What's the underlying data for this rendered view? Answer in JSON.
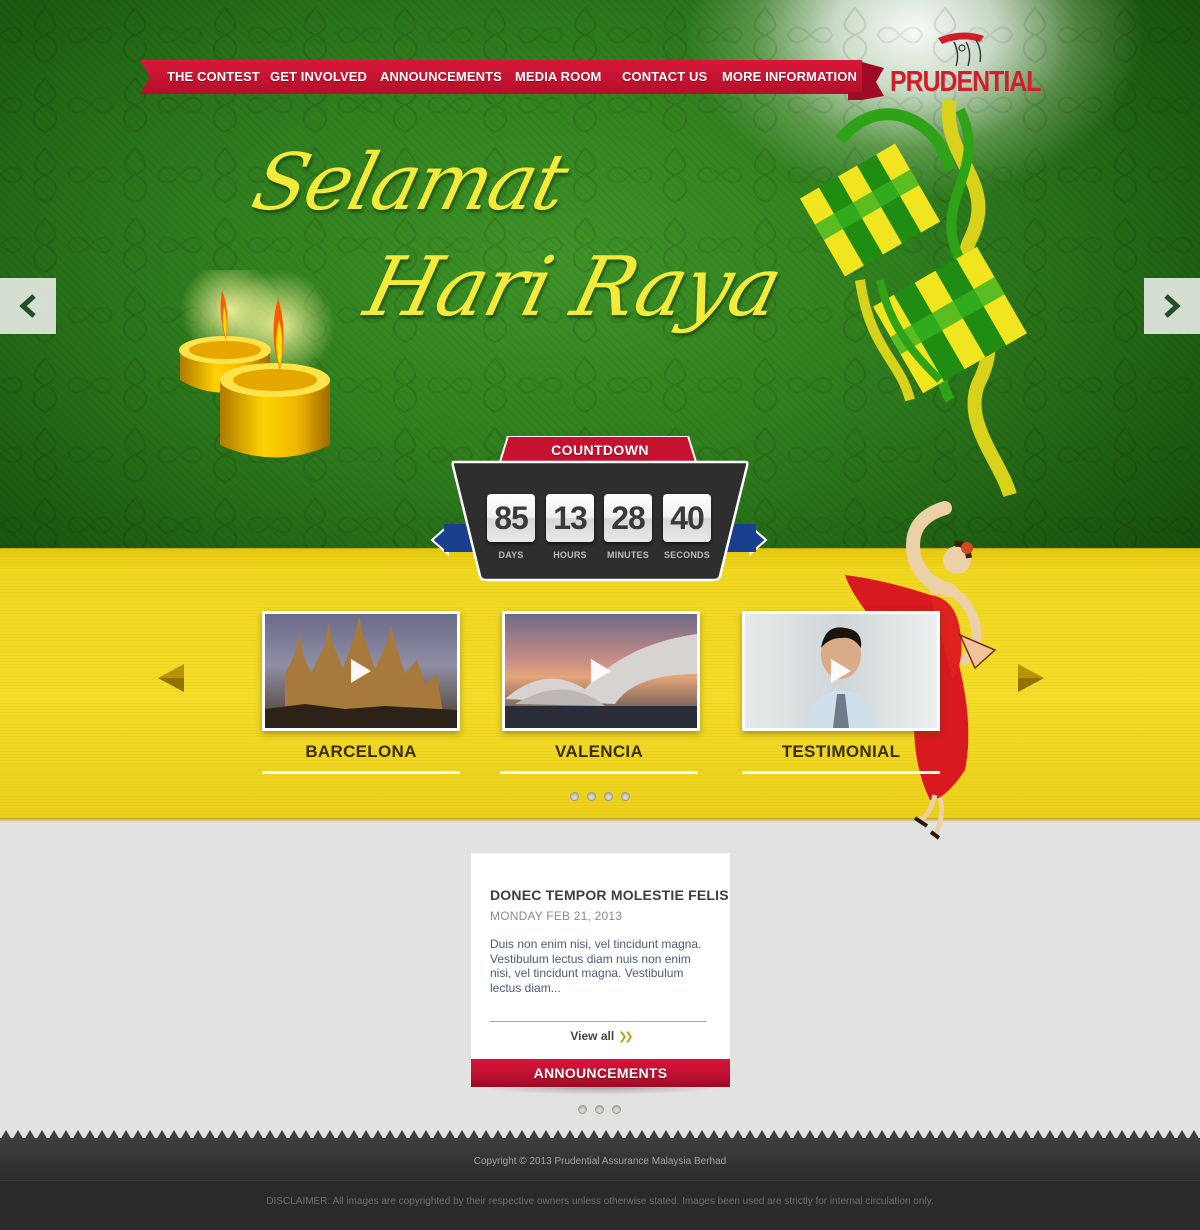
{
  "nav": {
    "items": [
      "THE CONTEST",
      "GET INVOLVED",
      "ANNOUNCEMENTS",
      "MEDIA ROOM",
      "CONTACT US",
      "MORE INFORMATION"
    ]
  },
  "brand": {
    "name": "PRUDENTIAL",
    "color": "#d21d2b"
  },
  "hero": {
    "greeting_line1": "Selamat",
    "greeting_line2": "Hari Raya",
    "prev_icon": "chevron-left-icon",
    "next_icon": "chevron-right-icon"
  },
  "countdown": {
    "title": "COUNTDOWN",
    "units": [
      {
        "value": "85",
        "label": "DAYS"
      },
      {
        "value": "13",
        "label": "HOURS"
      },
      {
        "value": "28",
        "label": "MINUTES"
      },
      {
        "value": "40",
        "label": "SECONDS"
      }
    ]
  },
  "videos": [
    {
      "title": "BARCELONA"
    },
    {
      "title": "VALENCIA"
    },
    {
      "title": "TESTIMONIAL"
    }
  ],
  "announcement": {
    "title": "DONEC TEMPOR MOLESTIE FELIS",
    "date": "MONDAY FEB 21, 2013",
    "body": "Duis non enim nisi, vel tincidunt magna. Vestibulum lectus diam nuis non enim nisi, vel tincidunt magna. Vestibulum lectus diam...",
    "view_all": "View all",
    "tab_label": "ANNOUNCEMENTS"
  },
  "footer": {
    "copyright": "Copyright © 2013 Prudential Assurance Malaysia Berhad",
    "disclaimer": "DISCLAIMER: All images are copyrighted by their respective owners unless otherwise stated. Images been used are strictly for internal circulation only."
  },
  "colors": {
    "nav_red": "#c4122f",
    "hero_green": "#2d7a1c",
    "band_yellow": "#f1d820",
    "countdown_dark": "#2e2e2e",
    "greeting_yellow": "#f3ea3a"
  }
}
